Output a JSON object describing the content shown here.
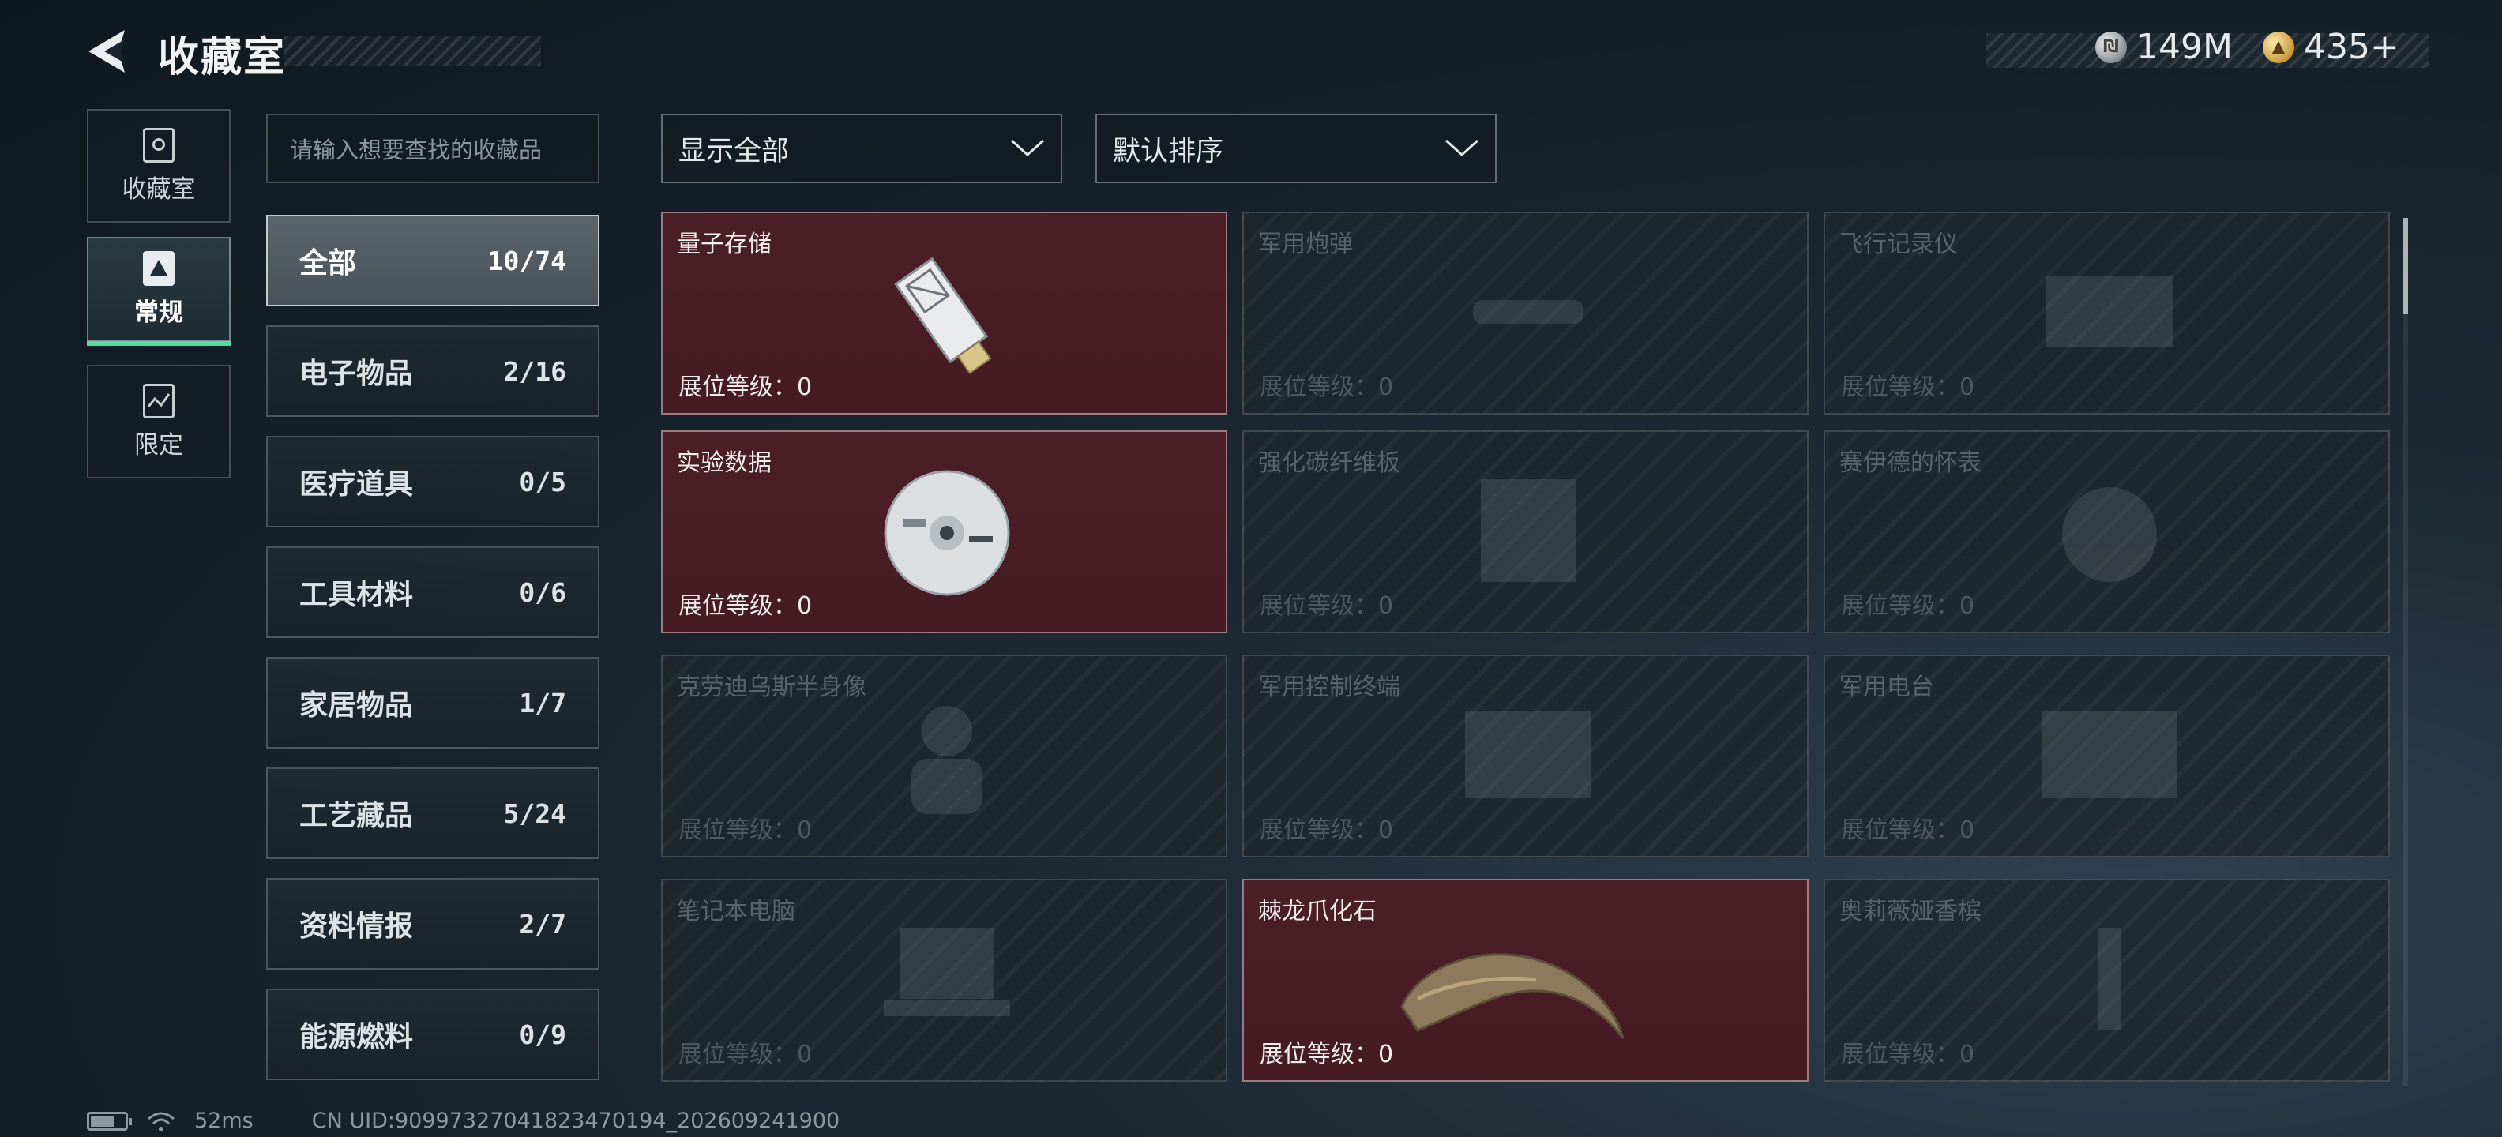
{
  "header": {
    "title": "收藏室",
    "currency": [
      {
        "icon": "silver-coin-icon",
        "value": "149M"
      },
      {
        "icon": "gold-coin-icon",
        "value": "435+"
      }
    ]
  },
  "side_tabs": [
    {
      "label": "收藏室",
      "icon": "collection-room-icon",
      "active": false
    },
    {
      "label": "常规",
      "icon": "regular-icon",
      "active": true
    },
    {
      "label": "限定",
      "icon": "limited-icon",
      "active": false
    }
  ],
  "search": {
    "placeholder": "请输入想要查找的收藏品"
  },
  "filters": {
    "display": "显示全部",
    "sort": "默认排序"
  },
  "categories": [
    {
      "name": "全部",
      "count": "10/74",
      "active": true
    },
    {
      "name": "电子物品",
      "count": "2/16"
    },
    {
      "name": "医疗道具",
      "count": "0/5"
    },
    {
      "name": "工具材料",
      "count": "0/6"
    },
    {
      "name": "家居物品",
      "count": "1/7"
    },
    {
      "name": "工艺藏品",
      "count": "5/24"
    },
    {
      "name": "资料情报",
      "count": "2/7"
    },
    {
      "name": "能源燃料",
      "count": "0/9"
    }
  ],
  "items": [
    {
      "name": "量子存储",
      "level": "展位等级：0",
      "owned": true,
      "art": "usb-drive"
    },
    {
      "name": "军用炮弹",
      "level": "展位等级：0",
      "owned": false,
      "art": "shell"
    },
    {
      "name": "飞行记录仪",
      "level": "展位等级：0",
      "owned": false,
      "art": "recorder"
    },
    {
      "name": "实验数据",
      "level": "展位等级：0",
      "owned": true,
      "art": "disc"
    },
    {
      "name": "强化碳纤维板",
      "level": "展位等级：0",
      "owned": false,
      "art": "panel"
    },
    {
      "name": "赛伊德的怀表",
      "level": "展位等级：0",
      "owned": false,
      "art": "watch"
    },
    {
      "name": "克劳迪乌斯半身像",
      "level": "展位等级：0",
      "owned": false,
      "art": "bust"
    },
    {
      "name": "军用控制终端",
      "level": "展位等级：0",
      "owned": false,
      "art": "terminal"
    },
    {
      "name": "军用电台",
      "level": "展位等级：0",
      "owned": false,
      "art": "radio"
    },
    {
      "name": "笔记本电脑",
      "level": "展位等级：0",
      "owned": false,
      "art": "laptop"
    },
    {
      "name": "棘龙爪化石",
      "level": "展位等级：0",
      "owned": true,
      "art": "claw"
    },
    {
      "name": "奥莉薇娅香槟",
      "level": "展位等级：0",
      "owned": false,
      "art": "bottle"
    }
  ],
  "footer": {
    "ping": "52ms",
    "uid": "CN UID:909973270418234701​94_202609241900"
  }
}
